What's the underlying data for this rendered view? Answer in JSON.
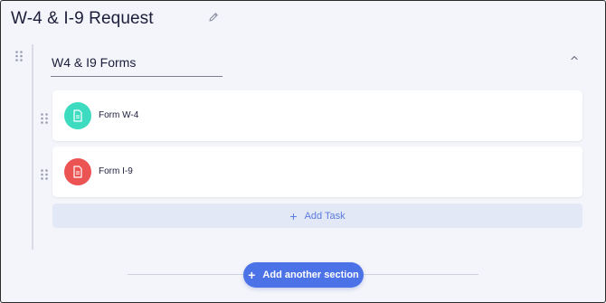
{
  "page": {
    "title": "W-4 & I-9 Request",
    "edit_icon": "pencil-icon"
  },
  "section": {
    "name": "W4 & I9 Forms",
    "collapse_icon": "chevron-up-icon",
    "drag_icon": "drag-handle-icon"
  },
  "tasks": [
    {
      "label": "Form W-4",
      "icon": "document-icon",
      "icon_color": "#3ddcc0"
    },
    {
      "label": "Form I-9",
      "icon": "document-icon",
      "icon_color": "#ec5353"
    }
  ],
  "add_task": {
    "label": "Add Task",
    "icon": "plus-icon"
  },
  "add_section": {
    "label": "Add another section",
    "icon": "plus-icon"
  },
  "colors": {
    "background": "#f4f5fa",
    "accent": "#4c72e8",
    "add_task_bg": "#e3e8f7",
    "add_task_text": "#5a7be0"
  }
}
